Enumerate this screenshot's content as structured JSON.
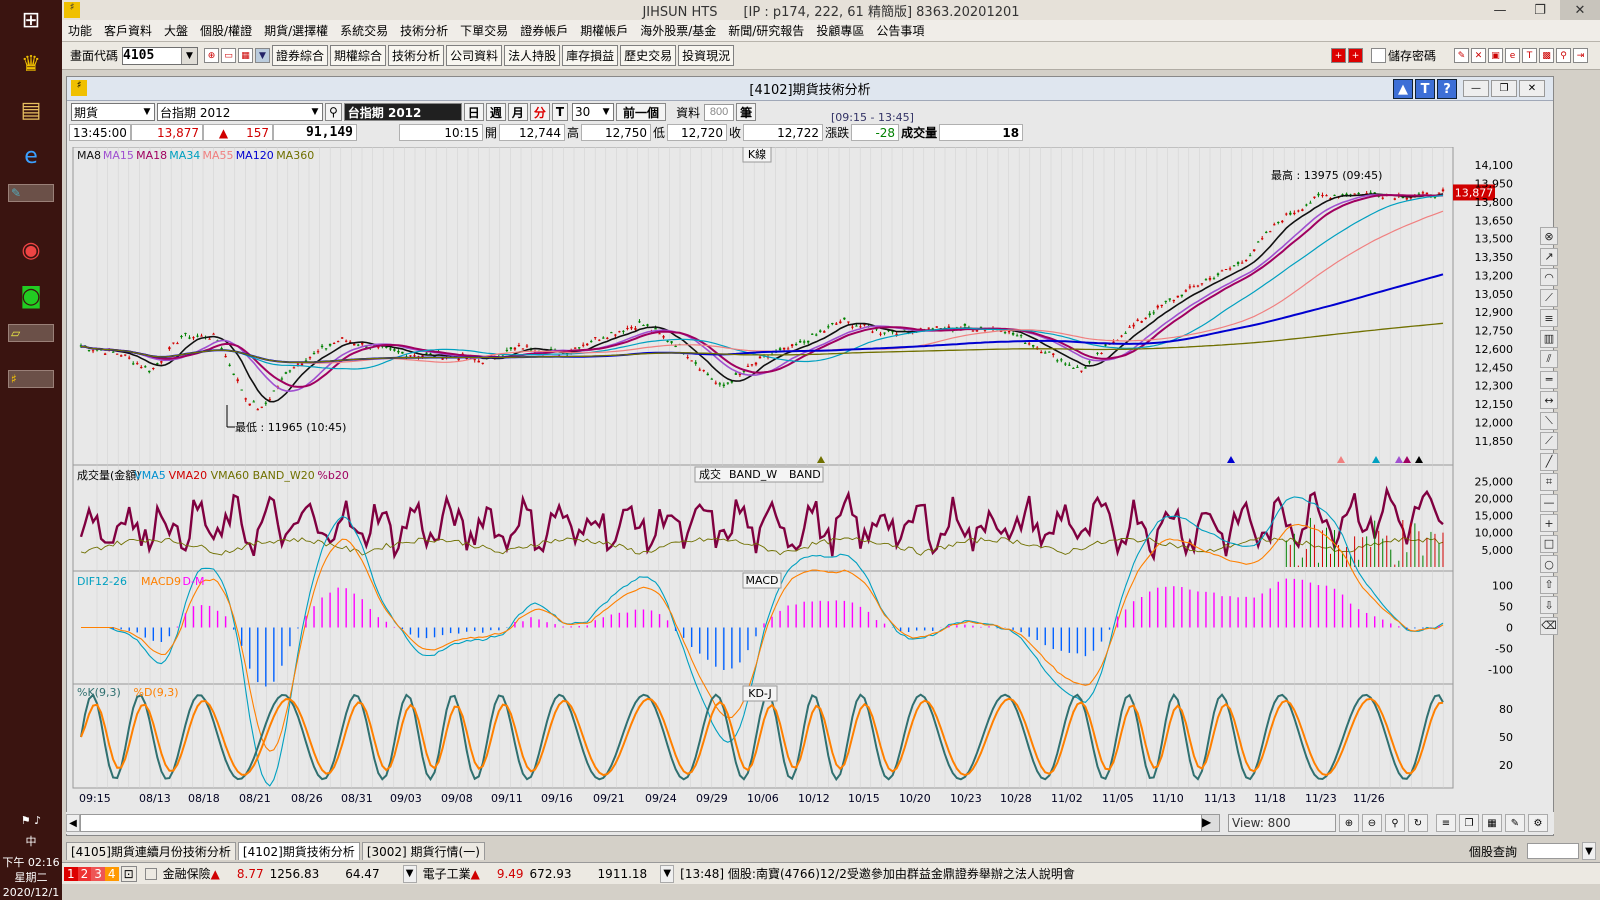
{
  "taskbar": {
    "ime": "中",
    "time": "下午 02:16",
    "weekday": "星期二",
    "date": "2020/12/1"
  },
  "window": {
    "title": "JIHSUN HTS　　[IP : p174, 222, 61 精簡版] 8363.20201201"
  },
  "menu": [
    "功能",
    "客戶資料",
    "大盤",
    "個股/權證",
    "期貨/選擇權",
    "系統交易",
    "技術分析",
    "下單交易",
    "證券帳戶",
    "期權帳戶",
    "海外股票/基金",
    "新聞/研究報告",
    "投顧專區",
    "公告事項"
  ],
  "toolbar": {
    "code_label": "畫面代碼",
    "code_value": "4105",
    "buttons": [
      "證券綜合",
      "期權綜合",
      "技術分析",
      "公司資料",
      "法人持股",
      "庫存損益",
      "歷史交易",
      "投資現況"
    ],
    "save_pwd": "儲存密碼"
  },
  "panel": {
    "title": "[4102]期貨技術分析",
    "type": "期貨",
    "symbol_dd": "台指期 2012",
    "symbol": "台指期 2012",
    "periods": [
      "日",
      "週",
      "月",
      "分",
      "T"
    ],
    "period_value": "30",
    "prev": "前一個",
    "data_label": "資料",
    "data_value": "800",
    "unit": "筆",
    "session": "[09:15 - 13:45]"
  },
  "quote": {
    "time": "13:45:00",
    "price": "13,877",
    "change": "157",
    "volume": "91,149",
    "bar_time": "10:15",
    "open_label": "開",
    "open": "12,744",
    "high_label": "高",
    "high": "12,750",
    "low_label": "低",
    "low": "12,720",
    "close_label": "收",
    "close": "12,722",
    "chg_label": "漲跌",
    "chg": "-28",
    "vol_label": "成交量",
    "vol": "18"
  },
  "chart": {
    "k": {
      "name": "K線",
      "ma_labels": [
        "MA8",
        "MA15",
        "MA18",
        "MA34",
        "MA55",
        "MA120",
        "MA360"
      ],
      "ma_colors": [
        "#111111",
        "#a050d0",
        "#a00060",
        "#00a0c0",
        "#f08080",
        "#0000d0",
        "#707000"
      ],
      "high_note": "最高 : 13975 (09:45)",
      "low_note": "最低 : 11965 (10:45)",
      "last": "13,877",
      "yticks": [
        "14,100",
        "13,950",
        "13,800",
        "13,650",
        "13,500",
        "13,350",
        "13,200",
        "13,050",
        "12,900",
        "12,750",
        "12,600",
        "12,450",
        "12,300",
        "12,150",
        "12,000",
        "11,850"
      ]
    },
    "vol": {
      "name": "成交",
      "band_w": "BAND_W",
      "band": "BAND",
      "labels": [
        "成交量(金額)",
        "VMA5",
        "VMA20",
        "VMA60",
        "BAND_W20",
        "%b20"
      ],
      "yticks": [
        "25,000",
        "20,000",
        "15,000",
        "10,000",
        "5,000"
      ]
    },
    "macd": {
      "name": "MACD",
      "labels": [
        "DIF12-26",
        "MACD9",
        "D-M"
      ],
      "yticks": [
        "100",
        "50",
        "0",
        "-50",
        "-100"
      ]
    },
    "kd": {
      "name": "KD-J",
      "labels": [
        "%K(9,3)",
        "%D(9,3)"
      ],
      "yticks": [
        "80",
        "50",
        "20"
      ]
    },
    "xlabels": [
      "09:15",
      "08/13",
      "08/18",
      "08/21",
      "08/26",
      "08/31",
      "09/03",
      "09/08",
      "09/11",
      "09/16",
      "09/21",
      "09/24",
      "09/29",
      "10/06",
      "10/12",
      "10/15",
      "10/20",
      "10/23",
      "10/28",
      "11/02",
      "11/05",
      "11/10",
      "11/13",
      "11/18",
      "11/23",
      "11/26"
    ],
    "view_label": "View: 800"
  },
  "tabs": [
    "[4105]期貨連續月份技術分析",
    "[4102]期貨技術分析",
    "[3002] 期貨行情(一)"
  ],
  "right_label": "個股查詢",
  "status": {
    "idx1_name": "金融保險",
    "idx1_chg": "8.77",
    "idx1_val": "1256.83",
    "idx1_v2": "64.47",
    "idx2_name": "電子工業",
    "idx2_chg": "9.49",
    "idx2_val": "672.93",
    "idx2_v2": "1911.18",
    "news": "[13:48] 個股:南寶(4766)12/2受邀參加由群益金鼎證券舉辦之法人說明會"
  }
}
